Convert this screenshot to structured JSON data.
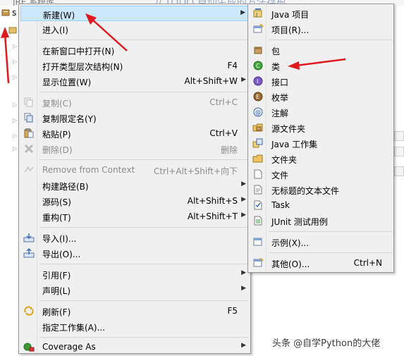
{
  "background": {
    "top_text": "JRE 系统库",
    "top_text_right": "// TODO 自动生成的方法存根",
    "left_label": "s"
  },
  "menu": {
    "items": [
      {
        "label": "新建(W)",
        "shortcut": "",
        "submenu": true,
        "icon": "none",
        "highlighted": true,
        "disabled": false
      },
      {
        "label": "进入(I)",
        "shortcut": "",
        "submenu": false,
        "icon": "none",
        "disabled": false
      },
      {
        "label": "在新窗口中打开(N)",
        "shortcut": "",
        "submenu": false,
        "icon": "none",
        "disabled": false
      },
      {
        "label": "打开类型层次结构(N)",
        "shortcut": "F4",
        "submenu": false,
        "icon": "none",
        "disabled": false
      },
      {
        "label": "显示位置(W)",
        "shortcut": "Alt+Shift+W",
        "submenu": true,
        "icon": "none",
        "disabled": false
      },
      {
        "label": "复制(C)",
        "shortcut": "Ctrl+C",
        "submenu": false,
        "icon": "copy-icon",
        "disabled": true
      },
      {
        "label": "复制限定名(Y)",
        "shortcut": "",
        "submenu": false,
        "icon": "copy-qualified-icon",
        "disabled": false
      },
      {
        "label": "粘贴(P)",
        "shortcut": "Ctrl+V",
        "submenu": false,
        "icon": "paste-icon",
        "disabled": false
      },
      {
        "label": "删除(D)",
        "shortcut": "删除",
        "submenu": false,
        "icon": "delete-icon",
        "disabled": true
      },
      {
        "label": "Remove from Context",
        "shortcut": "Ctrl+Alt+Shift+向下",
        "submenu": false,
        "icon": "remove-context-icon",
        "disabled": true
      },
      {
        "label": "构建路径(B)",
        "shortcut": "",
        "submenu": true,
        "icon": "none",
        "disabled": false
      },
      {
        "label": "源码(S)",
        "shortcut": "Alt+Shift+S",
        "submenu": true,
        "icon": "none",
        "disabled": false
      },
      {
        "label": "重构(T)",
        "shortcut": "Alt+Shift+T",
        "submenu": true,
        "icon": "none",
        "disabled": false
      },
      {
        "label": "导入(I)...",
        "shortcut": "",
        "submenu": false,
        "icon": "import-icon",
        "disabled": false
      },
      {
        "label": "导出(O)...",
        "shortcut": "",
        "submenu": false,
        "icon": "export-icon",
        "disabled": false
      },
      {
        "label": "引用(F)",
        "shortcut": "",
        "submenu": true,
        "icon": "none",
        "disabled": false
      },
      {
        "label": "声明(L)",
        "shortcut": "",
        "submenu": true,
        "icon": "none",
        "disabled": false
      },
      {
        "label": "刷新(F)",
        "shortcut": "F5",
        "submenu": false,
        "icon": "refresh-icon",
        "disabled": false
      },
      {
        "label": "指定工作集(A)...",
        "shortcut": "",
        "submenu": false,
        "icon": "none",
        "disabled": false
      },
      {
        "label": "Coverage As",
        "shortcut": "",
        "submenu": true,
        "icon": "coverage-icon",
        "disabled": false
      }
    ]
  },
  "submenu": {
    "items": [
      {
        "label": "Java 项目",
        "shortcut": "",
        "icon": "java-project-icon"
      },
      {
        "label": "项目(R)...",
        "shortcut": "",
        "icon": "project-icon"
      },
      {
        "label": "包",
        "shortcut": "",
        "icon": "package-icon"
      },
      {
        "label": "类",
        "shortcut": "",
        "icon": "class-icon"
      },
      {
        "label": "接口",
        "shortcut": "",
        "icon": "interface-icon"
      },
      {
        "label": "枚举",
        "shortcut": "",
        "icon": "enum-icon"
      },
      {
        "label": "注解",
        "shortcut": "",
        "icon": "annotation-icon"
      },
      {
        "label": "源文件夹",
        "shortcut": "",
        "icon": "source-folder-icon"
      },
      {
        "label": "Java 工作集",
        "shortcut": "",
        "icon": "java-working-set-icon"
      },
      {
        "label": "文件夹",
        "shortcut": "",
        "icon": "folder-icon"
      },
      {
        "label": "文件",
        "shortcut": "",
        "icon": "file-icon"
      },
      {
        "label": "无标题的文本文件",
        "shortcut": "",
        "icon": "untitled-text-file-icon"
      },
      {
        "label": "Task",
        "shortcut": "",
        "icon": "task-icon"
      },
      {
        "label": "JUnit 测试用例",
        "shortcut": "",
        "icon": "junit-test-icon"
      },
      {
        "label": "示例(X)...",
        "shortcut": "",
        "icon": "example-icon"
      },
      {
        "label": "其他(O)...",
        "shortcut": "Ctrl+N",
        "icon": "other-icon"
      }
    ]
  },
  "watermark": "头条 @自学Python的大佬",
  "colors": {
    "menu_bg": "#f0f0f0",
    "highlight_bg": "#cce8ff",
    "highlight_border": "#99d1ff",
    "arrow": "#e0191f",
    "disabled_text": "#8b8b8b"
  }
}
